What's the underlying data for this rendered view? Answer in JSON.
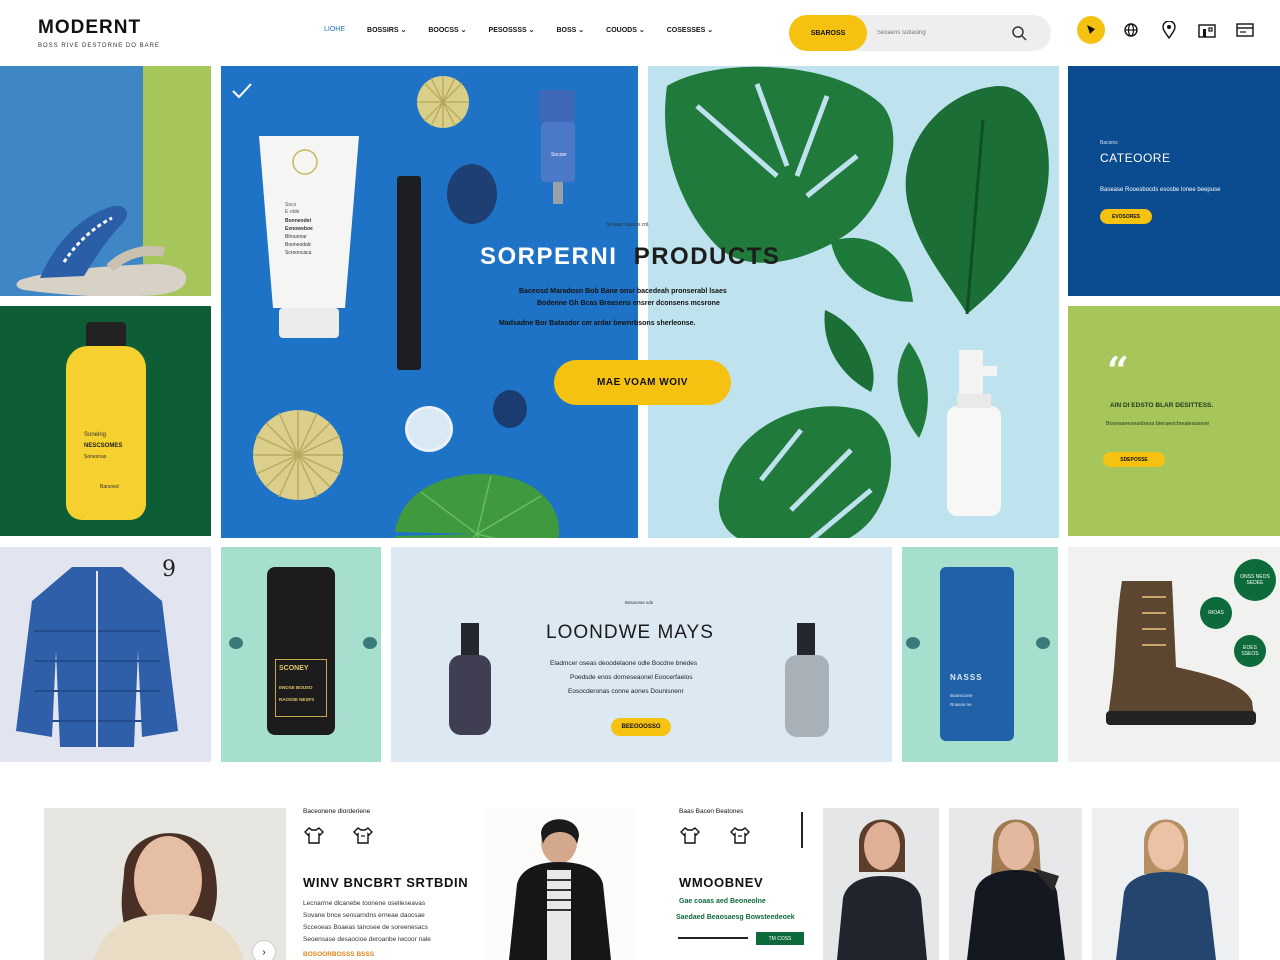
{
  "brand": {
    "logo": "MODERNT",
    "tagline": "BOSS RIVE DESTORNE DO BARE"
  },
  "nav": {
    "items": [
      {
        "label": "LIOHE",
        "has_chevron": false,
        "active": true
      },
      {
        "label": "BOSSIRS",
        "has_chevron": true
      },
      {
        "label": "BOOCSS",
        "has_chevron": true
      },
      {
        "label": "PESOSSSS",
        "has_chevron": true
      },
      {
        "label": "BOSS",
        "has_chevron": true
      },
      {
        "label": "COUODS",
        "has_chevron": true
      },
      {
        "label": "COSESSES",
        "has_chevron": true
      }
    ]
  },
  "search": {
    "button_label": "SBAROSS",
    "placeholder": "Sexaens sutlasing"
  },
  "header_icons": [
    "cart-icon",
    "globe-icon",
    "location-pin-icon",
    "store-icon",
    "card-icon"
  ],
  "hero": {
    "kicker": "Sonaan sauvos cnl.",
    "title_left": "SORPERNI",
    "title_right": "PRODUCTS",
    "lines": [
      "Baceosd Maradosn Bob Bane onsr bacedeah pronserabl lsaes",
      "Bodenne Gh Bcas Breasens ensrer dconsens mcsrone",
      "Madsadne Bor Batasdor cer ardar bewnrbsons sherleonse."
    ],
    "cta": "MAE VOAM WOIV"
  },
  "product_labels": {
    "yellow_bottle": [
      "Sonelng",
      "NESCSOMES",
      "Sonesnas",
      "Barsoed"
    ],
    "tube": [
      "Socs",
      "E·olde",
      "Bonneodet",
      "Exnoweboe",
      "Blrouonar",
      "Booneodalc",
      "Scrooncaca"
    ],
    "blue_bottle": "Socoer",
    "black_jar": [
      "SCONEY",
      "ENOSE BOUSO",
      "RAOSSE NESFS"
    ],
    "blue_tube": [
      "NASSS",
      "Boanscone",
      "Roasse ne"
    ]
  },
  "category": {
    "kicker": "Baciens",
    "title": "CATEOORE",
    "line": "Basease Rooesbocds esosbe lonee beepuse",
    "button": "EVOSORES"
  },
  "quote": {
    "mark": "“",
    "line1": "AIN DI EDSTO BLAR DESITTESS.",
    "line2": "Bosnsaeeseaidresa bieraeocfsealeaosese",
    "button": "SDEPOSSE"
  },
  "middle": {
    "kicker": "Besovnas sds",
    "title": "LOONDWE MAYS",
    "lines": [
      "Eladmcer oseas deoodelaone odle Bocdne bnedes",
      "Poedsde enos dorneseaonel Eoocerfaelos",
      "Eosocderonas conne aones Dounisnenr"
    ],
    "cta": "BEEOOOSSO"
  },
  "boot_badges": [
    "ONSS NEOS SEDEE",
    "RIOAS",
    "EOES SSEOS"
  ],
  "jacket_tag": "9",
  "section_left": {
    "kicker": "Baceonene dlorderiene",
    "title": "WINV BNCBRT SRTBDIN",
    "lines": [
      "Lecnarrne dlcanebe toonene oselleseavas",
      "Sovane bnce sensarndns erneae daocsae",
      "Scceoeas Boaeas tanosee de soreenesacs",
      "Seoensase desaocioe deroanbe iwcoor nale"
    ],
    "orange": "BOSOORBOSSS BSSS"
  },
  "section_right": {
    "kicker": "Baas Bacen Beatones",
    "title": "WMOOBNEV",
    "green_lines": [
      "Gae coaas aed Beoneolne",
      "Saedaed Beaosaesg Bowsteedeoek"
    ],
    "tag": "TM COSS"
  }
}
